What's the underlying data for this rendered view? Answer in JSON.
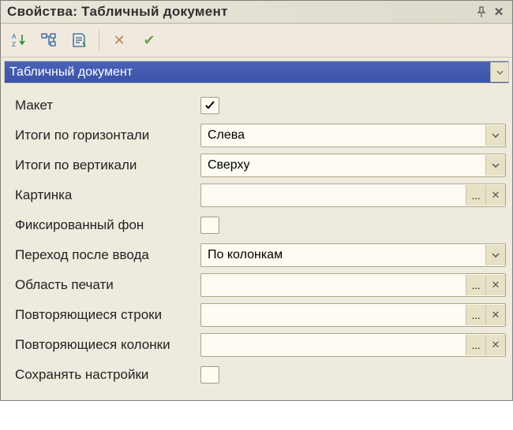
{
  "window": {
    "title": "Свойства: Табличный документ"
  },
  "section": {
    "label": "Табличный документ"
  },
  "props": {
    "template": {
      "label": "Макет",
      "kind": "check",
      "checked": true
    },
    "totals_h": {
      "label": "Итоги по горизонтали",
      "kind": "combo",
      "value": "Слева"
    },
    "totals_v": {
      "label": "Итоги по вертикали",
      "kind": "combo",
      "value": "Сверху"
    },
    "picture": {
      "label": "Картинка",
      "kind": "picker",
      "value": ""
    },
    "fixed_bg": {
      "label": "Фиксированный фон",
      "kind": "check",
      "checked": false
    },
    "enter_move": {
      "label": "Переход после ввода",
      "kind": "combo",
      "value": "По колонкам"
    },
    "print_area": {
      "label": "Область печати",
      "kind": "picker",
      "value": ""
    },
    "repeat_rows": {
      "label": "Повторяющиеся строки",
      "kind": "picker",
      "value": ""
    },
    "repeat_cols": {
      "label": "Повторяющиеся колонки",
      "kind": "picker",
      "value": ""
    },
    "save_settings": {
      "label": "Сохранять настройки",
      "kind": "check",
      "checked": false
    }
  },
  "buttons": {
    "ellipsis": "...",
    "clear": "✕"
  }
}
